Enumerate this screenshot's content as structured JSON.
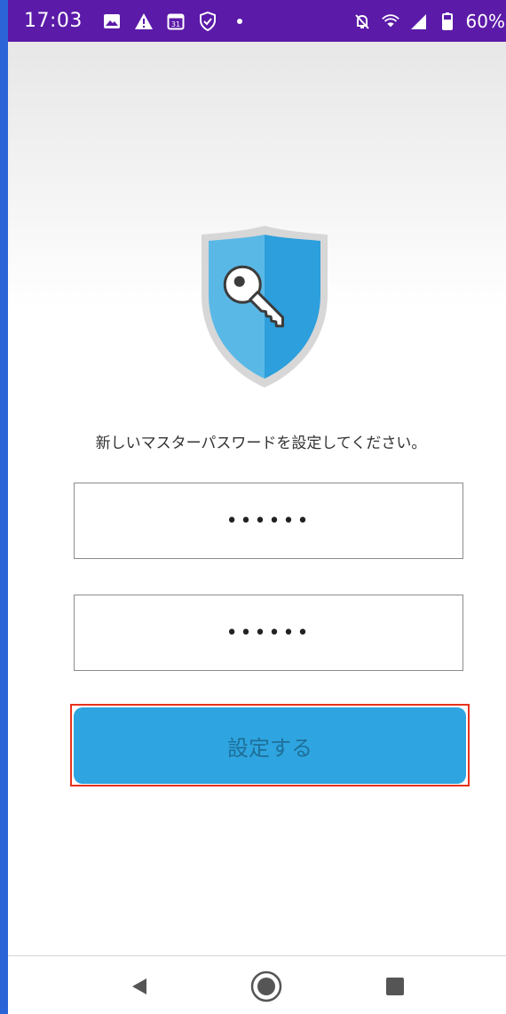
{
  "status_bar": {
    "time": "17:03",
    "battery": "60%",
    "left_icons": [
      "image-icon",
      "warning-icon",
      "calendar-icon",
      "shield-check-icon",
      "dot-icon"
    ],
    "right_icons": [
      "silent-icon",
      "wifi-icon",
      "signal-icon",
      "battery-icon"
    ],
    "calendar_day": "31"
  },
  "main": {
    "instruction": "新しいマスターパスワードを設定してください。",
    "password_field_1": {
      "value": "••••••"
    },
    "password_field_2": {
      "value": "••••••"
    },
    "submit_label": "設定する"
  },
  "nav_bar": {
    "buttons": [
      "back-icon",
      "home-icon",
      "recent-apps-icon"
    ]
  },
  "colors": {
    "status_bar": "#5b1aa8",
    "button": "#2ea5e0",
    "button_text": "#1e6f99",
    "highlight": "#e8321c",
    "shield_light": "#5ab8e6",
    "shield_dark": "#2c9fdc"
  }
}
